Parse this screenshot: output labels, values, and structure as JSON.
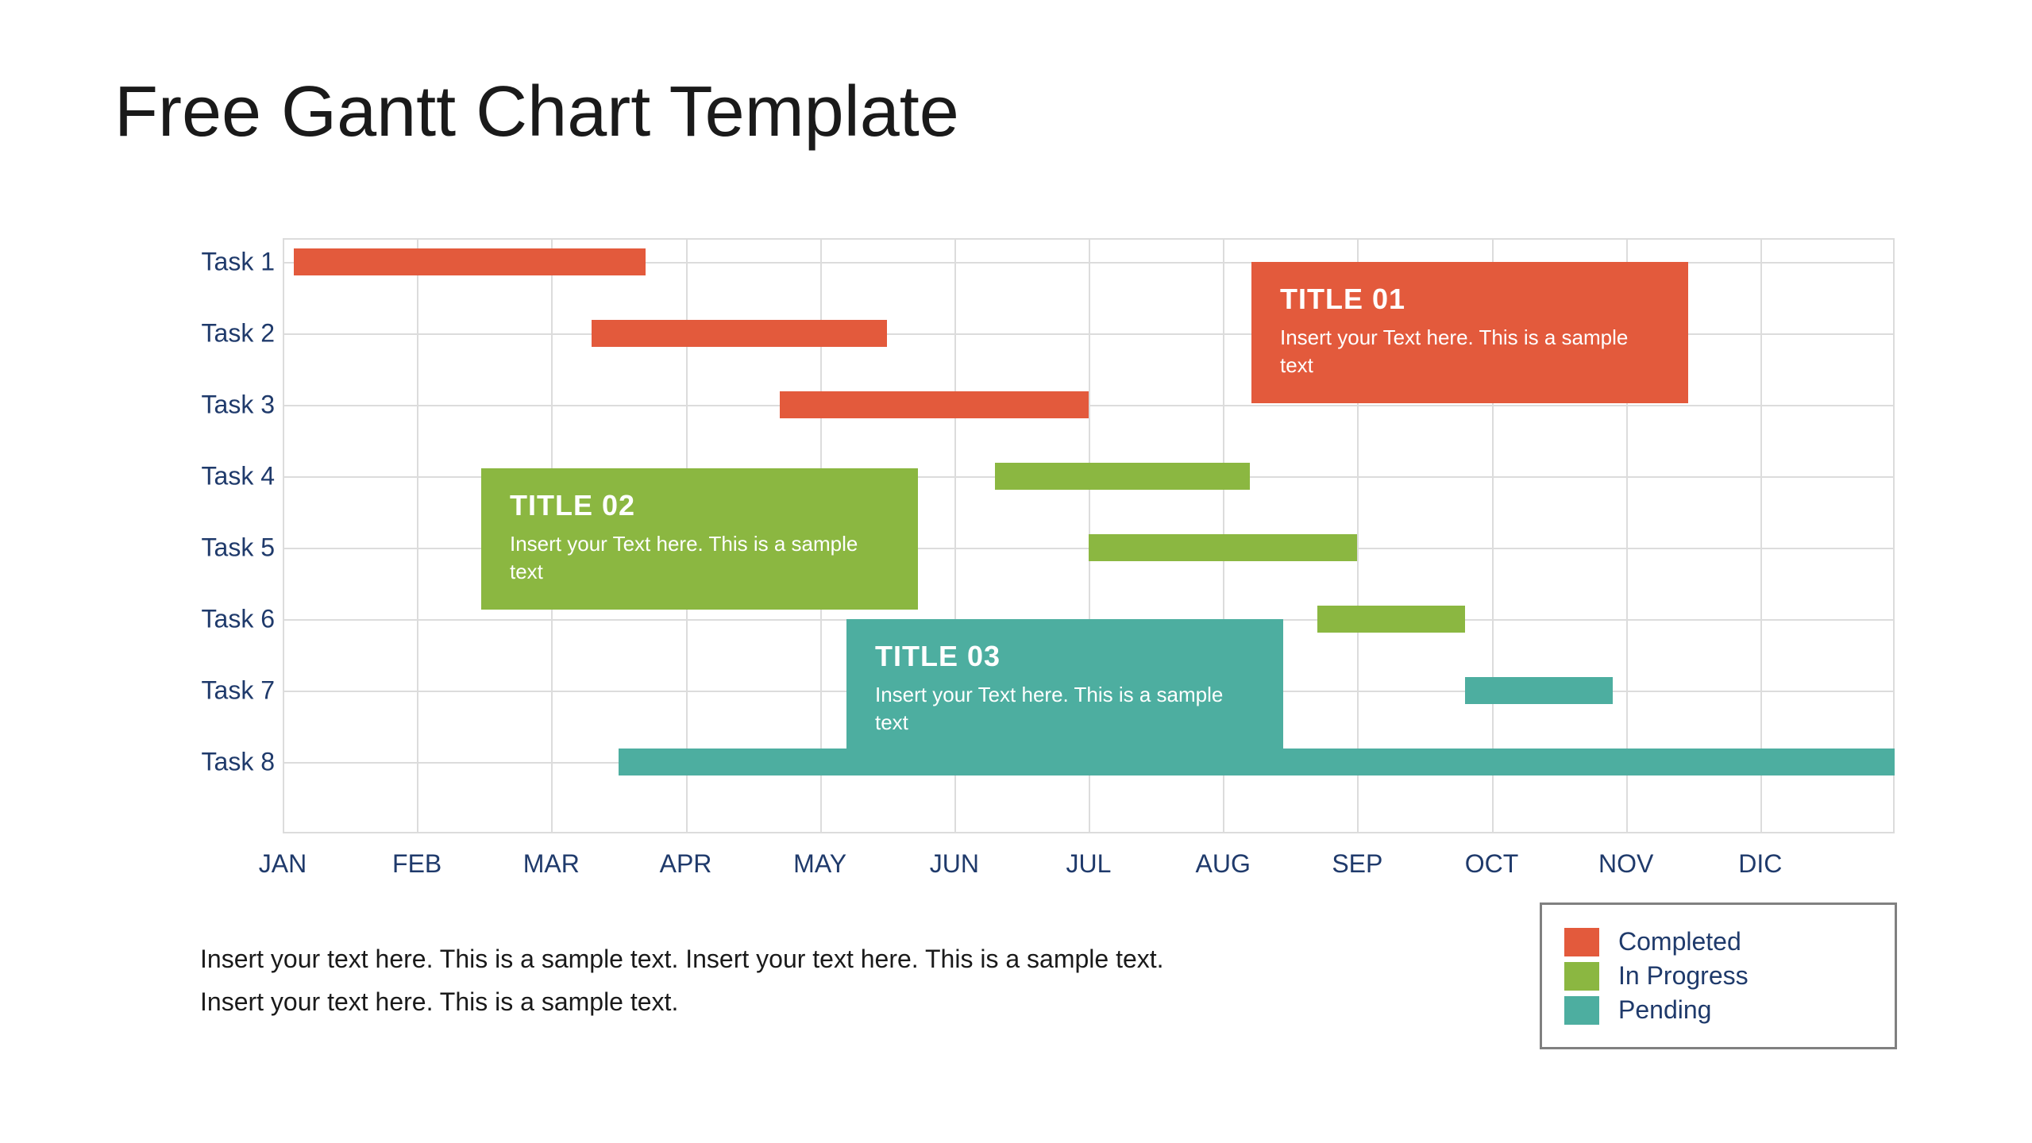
{
  "title": "Free Gantt Chart Template",
  "footer_line1": "Insert your text here. This is a sample text. Insert your text here. This is a sample text.",
  "footer_line2": "Insert your text here. This is a sample text.",
  "legend": {
    "completed": "Completed",
    "in_progress": "In Progress",
    "pending": "Pending"
  },
  "colors": {
    "completed": "#e35a3c",
    "in_progress": "#8bb741",
    "pending": "#4daea0"
  },
  "callouts": {
    "c1": {
      "title": "TITLE 01",
      "body": "Insert your Text here. This is a sample text"
    },
    "c2": {
      "title": "TITLE 02",
      "body": "Insert your Text here. This is a sample text"
    },
    "c3": {
      "title": "TITLE 03",
      "body": "Insert your Text here. This is a sample text"
    }
  },
  "chart_data": {
    "type": "gantt",
    "title": "Free Gantt Chart Template",
    "xlabel": "",
    "ylabel": "",
    "x_categories": [
      "JAN",
      "FEB",
      "MAR",
      "APR",
      "MAY",
      "JUN",
      "JUL",
      "AUG",
      "SEP",
      "OCT",
      "NOV",
      "DIC"
    ],
    "y_categories": [
      "Task 1",
      "Task 2",
      "Task 3",
      "Task 4",
      "Task 5",
      "Task 6",
      "Task 7",
      "Task 8"
    ],
    "x_range": [
      0,
      12
    ],
    "tasks": [
      {
        "name": "Task 1",
        "start": 0.08,
        "end": 2.7,
        "status": "completed"
      },
      {
        "name": "Task 2",
        "start": 2.3,
        "end": 4.5,
        "status": "completed"
      },
      {
        "name": "Task 3",
        "start": 3.7,
        "end": 6.0,
        "status": "completed"
      },
      {
        "name": "Task 4",
        "start": 5.3,
        "end": 7.2,
        "status": "in_progress"
      },
      {
        "name": "Task 5",
        "start": 6.0,
        "end": 8.0,
        "status": "in_progress"
      },
      {
        "name": "Task 6",
        "start": 7.7,
        "end": 8.8,
        "status": "in_progress"
      },
      {
        "name": "Task 7",
        "start": 8.8,
        "end": 9.9,
        "status": "pending"
      },
      {
        "name": "Task 8",
        "start": 2.5,
        "end": 12.0,
        "status": "pending"
      }
    ],
    "status_colors": {
      "completed": "#e35a3c",
      "in_progress": "#8bb741",
      "pending": "#4daea0"
    },
    "legend": [
      {
        "label": "Completed",
        "status": "completed"
      },
      {
        "label": "In Progress",
        "status": "in_progress"
      },
      {
        "label": "Pending",
        "status": "pending"
      }
    ],
    "annotations": [
      {
        "title": "TITLE 01",
        "text": "Insert your Text here. This is a sample text",
        "color": "#e35a3c"
      },
      {
        "title": "TITLE 02",
        "text": "Insert your Text here. This is a sample text",
        "color": "#8bb741"
      },
      {
        "title": "TITLE 03",
        "text": "Insert your Text here. This is a sample text",
        "color": "#4daea0"
      }
    ]
  }
}
